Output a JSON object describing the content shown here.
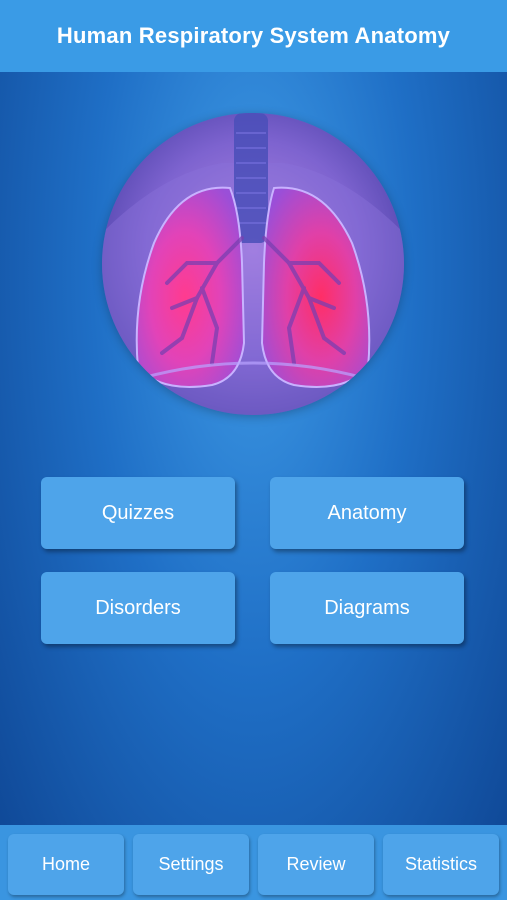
{
  "header": {
    "title": "Human Respiratory System Anatomy"
  },
  "hero": {
    "icon": "lungs-illustration"
  },
  "menu": {
    "quizzes": "Quizzes",
    "anatomy": "Anatomy",
    "disorders": "Disorders",
    "diagrams": "Diagrams"
  },
  "tabbar": {
    "home": "Home",
    "settings": "Settings",
    "review": "Review",
    "statistics": "Statistics"
  },
  "colors": {
    "header": "#3a9be6",
    "button": "#4ea4ea",
    "background_top": "#3f9be6",
    "background_bottom": "#0e4593",
    "lung_highlight": "#ff2e7a"
  }
}
